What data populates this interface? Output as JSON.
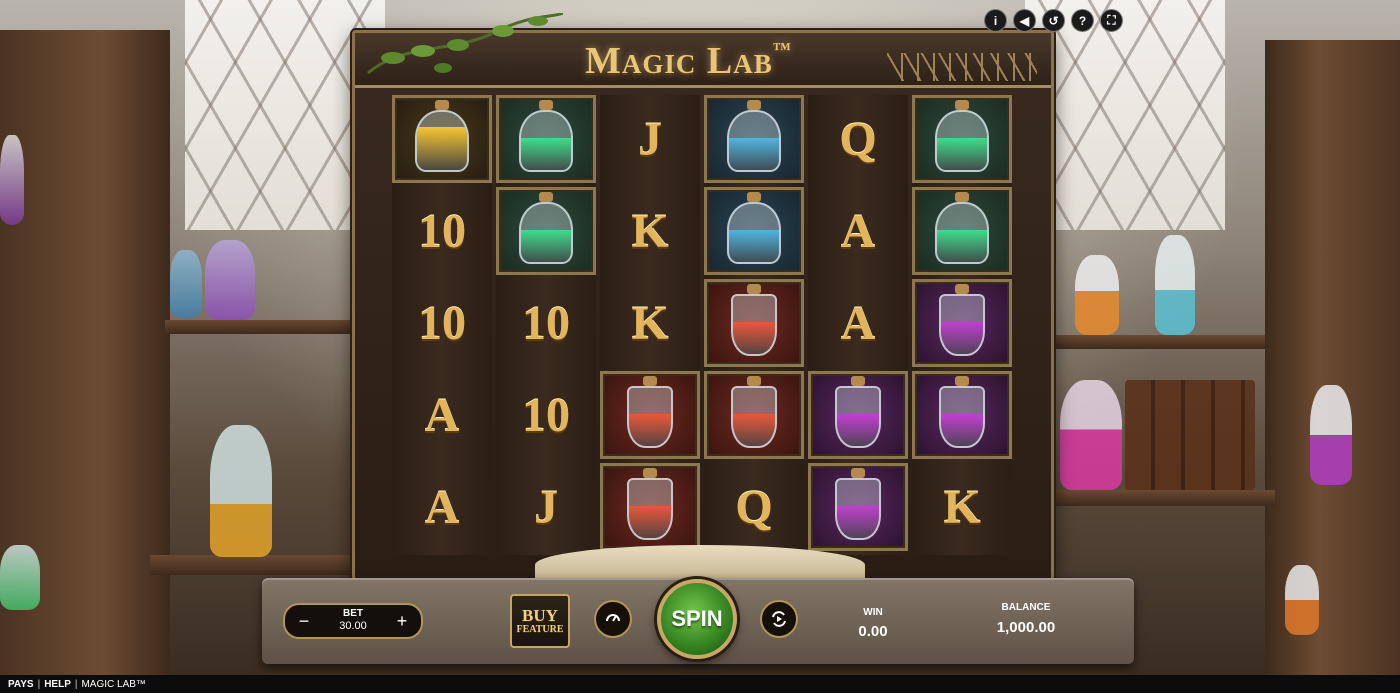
{
  "game": {
    "title": "Magic Lab",
    "trademark": "™"
  },
  "top_icons": [
    {
      "name": "info-icon",
      "glyph": "i"
    },
    {
      "name": "sound-icon",
      "glyph": "◀"
    },
    {
      "name": "history-icon",
      "glyph": "↺"
    },
    {
      "name": "help-icon",
      "glyph": "?"
    },
    {
      "name": "fullscreen-icon",
      "glyph": "⛶"
    }
  ],
  "reels": [
    [
      {
        "type": "potion",
        "color": "yellow",
        "shape": "jar"
      },
      {
        "type": "symbol",
        "text": "10"
      },
      {
        "type": "symbol",
        "text": "10"
      },
      {
        "type": "symbol",
        "text": "A"
      },
      {
        "type": "symbol",
        "text": "A"
      }
    ],
    [
      {
        "type": "potion",
        "color": "green",
        "shape": "round"
      },
      {
        "type": "potion",
        "color": "green",
        "shape": "round"
      },
      {
        "type": "symbol",
        "text": "10"
      },
      {
        "type": "symbol",
        "text": "10"
      },
      {
        "type": "symbol",
        "text": "J"
      }
    ],
    [
      {
        "type": "symbol",
        "text": "J"
      },
      {
        "type": "symbol",
        "text": "K"
      },
      {
        "type": "symbol",
        "text": "K"
      },
      {
        "type": "potion",
        "color": "red",
        "shape": "flask"
      },
      {
        "type": "potion",
        "color": "red",
        "shape": "flask"
      }
    ],
    [
      {
        "type": "potion",
        "color": "blue",
        "shape": "round"
      },
      {
        "type": "potion",
        "color": "blue",
        "shape": "round"
      },
      {
        "type": "potion",
        "color": "red",
        "shape": "flask"
      },
      {
        "type": "potion",
        "color": "red",
        "shape": "flask"
      },
      {
        "type": "symbol",
        "text": "Q"
      }
    ],
    [
      {
        "type": "symbol",
        "text": "Q"
      },
      {
        "type": "symbol",
        "text": "A"
      },
      {
        "type": "symbol",
        "text": "A"
      },
      {
        "type": "potion",
        "color": "purple",
        "shape": "flask"
      },
      {
        "type": "potion",
        "color": "purple",
        "shape": "flask"
      }
    ],
    [
      {
        "type": "potion",
        "color": "green",
        "shape": "round"
      },
      {
        "type": "potion",
        "color": "green",
        "shape": "round"
      },
      {
        "type": "potion",
        "color": "purple",
        "shape": "flask"
      },
      {
        "type": "potion",
        "color": "purple",
        "shape": "flask"
      },
      {
        "type": "symbol",
        "text": "K"
      }
    ]
  ],
  "colors": {
    "yellow": "#f5c531",
    "green": "#3fdc8c",
    "blue": "#4fb4e0",
    "red": "#e8583a",
    "purple": "#c23fd2",
    "gold": "#e2b55c",
    "spin_green": "#3f9a28"
  },
  "controls": {
    "bet_label": "BET",
    "bet_value": "30.00",
    "bet_minus": "−",
    "bet_plus": "+",
    "buy_line1": "BUY",
    "buy_line2": "FEATURE",
    "turbo_icon": "turbo-icon",
    "spin_label": "SPIN",
    "autoplay_icon": "autoplay-icon",
    "win_label": "WIN",
    "win_value": "0.00",
    "balance_label": "BALANCE",
    "balance_value": "1,000.00"
  },
  "footer": {
    "pays": "PAYS",
    "help": "HELP",
    "game_name": "MAGIC LAB™"
  }
}
